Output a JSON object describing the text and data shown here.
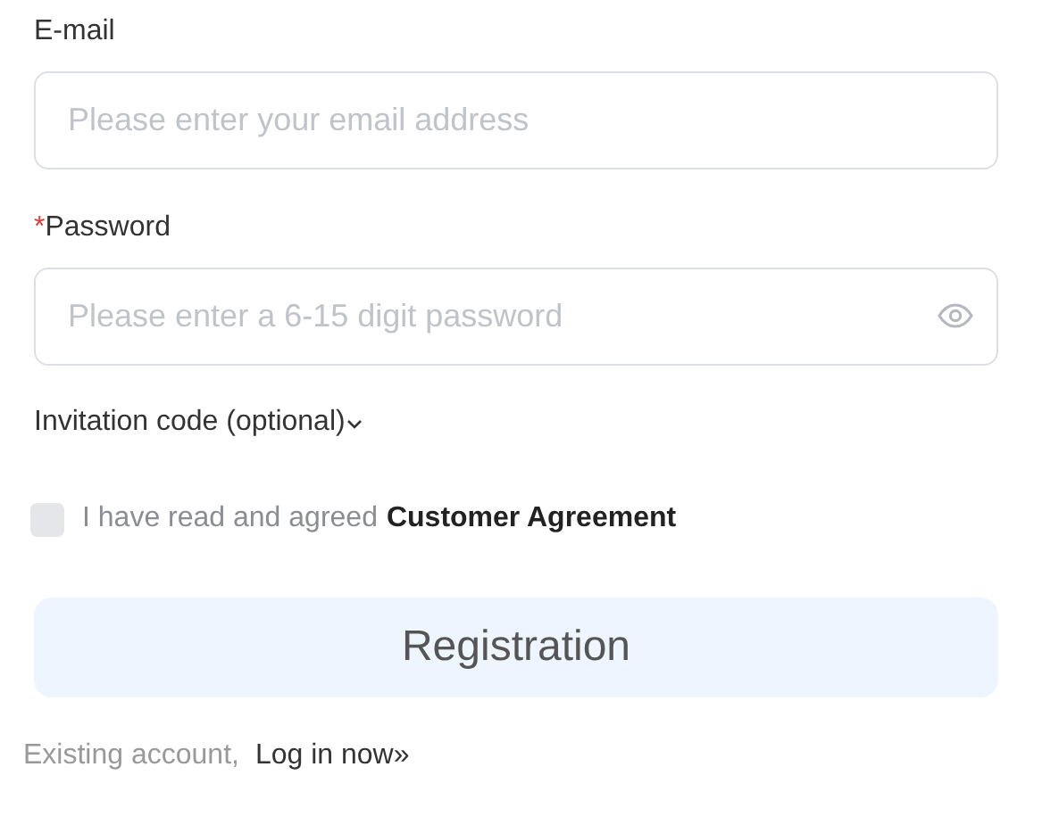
{
  "fields": [
    {
      "label": "E-mail",
      "placeholder": "Please enter your email address",
      "kind": "text"
    },
    {
      "label": "Password",
      "required_mark": "*",
      "placeholder": "Please enter a 6-15 digit password",
      "kind": "password"
    }
  ],
  "invitation": {
    "label": "Invitation code (optional)"
  },
  "agreement": {
    "checked": false,
    "text": "I have read and agreed",
    "link": "Customer Agreement"
  },
  "submit": {
    "label": "Registration"
  },
  "footer": {
    "text": "Existing account,",
    "link": "Log in now»"
  }
}
